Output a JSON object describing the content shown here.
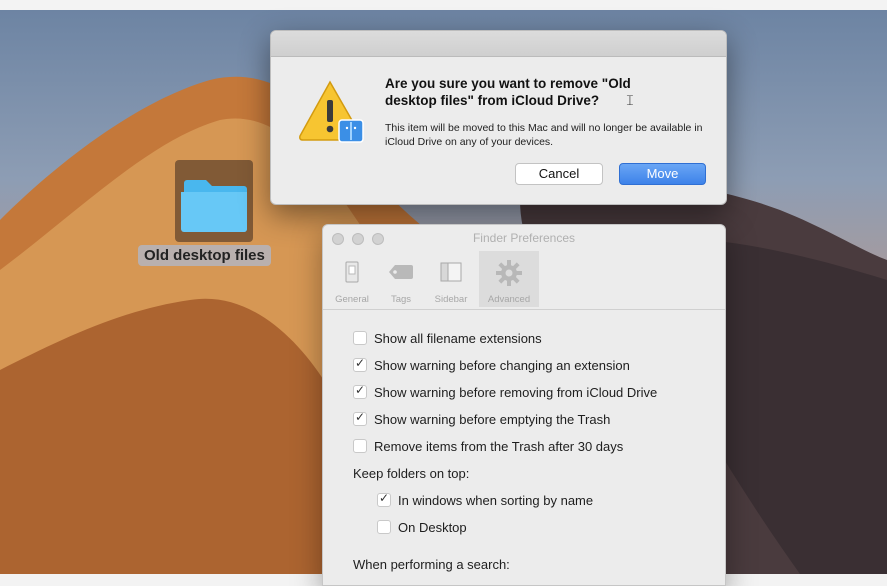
{
  "desktop": {
    "folder_label": "Old desktop files"
  },
  "alert": {
    "title": "Are you sure you want to remove \"Old desktop files\" from iCloud Drive?",
    "message": "This item will be moved to this Mac and will no longer be available in iCloud Drive on any of your devices.",
    "cancel_label": "Cancel",
    "move_label": "Move",
    "icon": "warning-icon"
  },
  "prefs": {
    "title": "Finder Preferences",
    "tabs": [
      {
        "label": "General",
        "icon": "general-icon"
      },
      {
        "label": "Tags",
        "icon": "tag-icon"
      },
      {
        "label": "Sidebar",
        "icon": "sidebar-icon"
      },
      {
        "label": "Advanced",
        "icon": "gear-icon"
      }
    ],
    "selected_tab": "Advanced",
    "options": [
      {
        "label": "Show all filename extensions",
        "checked": false
      },
      {
        "label": "Show warning before changing an extension",
        "checked": true
      },
      {
        "label": "Show warning before removing from iCloud Drive",
        "checked": true
      },
      {
        "label": "Show warning before emptying the Trash",
        "checked": true
      },
      {
        "label": "Remove items from the Trash after 30 days",
        "checked": false
      }
    ],
    "folders_heading": "Keep folders on top:",
    "folders_options": [
      {
        "label": "In windows when sorting by name",
        "checked": true
      },
      {
        "label": "On Desktop",
        "checked": false
      }
    ],
    "search_heading": "When performing a search:"
  }
}
